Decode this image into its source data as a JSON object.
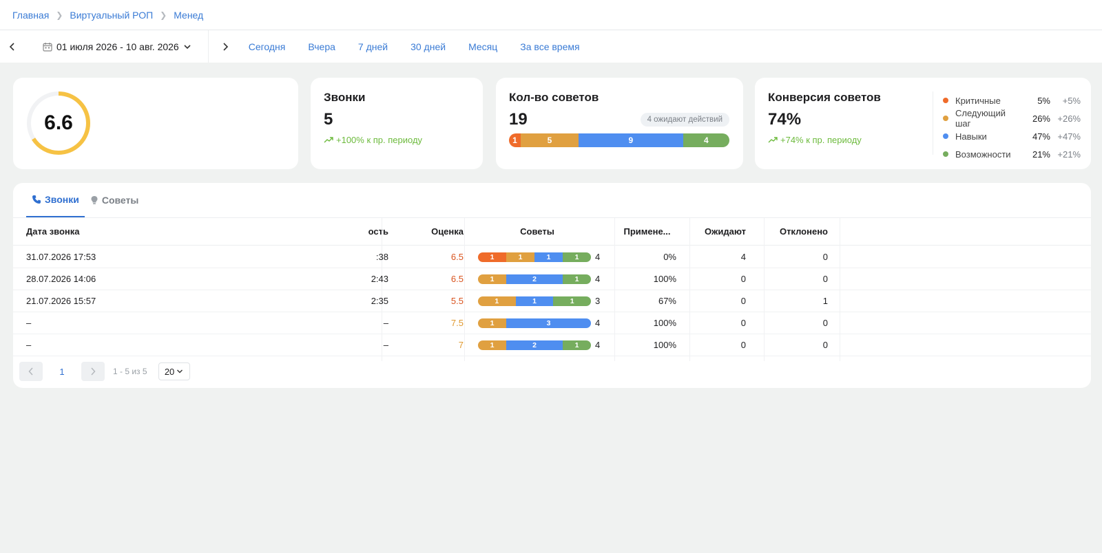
{
  "breadcrumb": [
    "Главная",
    "Виртуальный РОП",
    "Менед"
  ],
  "datebar": {
    "range": "01 июля 2026 - 10 авг. 2026",
    "quick": [
      "Сегодня",
      "Вчера",
      "7 дней",
      "30 дней",
      "Месяц",
      "За все время"
    ]
  },
  "score": {
    "value": "6.6",
    "fraction": 0.66,
    "color": "#f6c244"
  },
  "calls": {
    "title": "Звонки",
    "value": "5",
    "trend": "+100% к пр. периоду"
  },
  "tips": {
    "title": "Кол-во советов",
    "value": "19",
    "badge": "4 ожидают действий",
    "segments": [
      {
        "value": "1",
        "n": 1,
        "color": "#ef6b2a"
      },
      {
        "value": "5",
        "n": 5,
        "color": "#e0a040"
      },
      {
        "value": "9",
        "n": 9,
        "color": "#4f8ef0"
      },
      {
        "value": "4",
        "n": 4,
        "color": "#76ad5e"
      }
    ]
  },
  "conversion": {
    "title": "Конверсия советов",
    "value": "74%",
    "trend": "+74% к пр. периоду",
    "legend": [
      {
        "label": "Критичные",
        "pct": "5%",
        "delta": "+5%",
        "color": "#ef6b2a"
      },
      {
        "label": "Следующий шаг",
        "pct": "26%",
        "delta": "+26%",
        "color": "#e0a040"
      },
      {
        "label": "Навыки",
        "pct": "47%",
        "delta": "+47%",
        "color": "#4f8ef0"
      },
      {
        "label": "Возможности",
        "pct": "21%",
        "delta": "+21%",
        "color": "#76ad5e"
      }
    ]
  },
  "tabs": [
    "Звонки",
    "Советы"
  ],
  "table": {
    "headers": {
      "date": "Дата звонка",
      "duration": "ость",
      "score": "Оценка",
      "tips": "Советы",
      "applied": "Примене...",
      "waiting": "Ожидают",
      "rejected": "Отклонено"
    },
    "rows": [
      {
        "date": "31.07.2026 17:53",
        "duration": ":38",
        "score": "6.5",
        "score_color": "#d9531e",
        "tips": [
          {
            "v": "1",
            "c": "#ef6b2a"
          },
          {
            "v": "1",
            "c": "#e0a040"
          },
          {
            "v": "1",
            "c": "#4f8ef0"
          },
          {
            "v": "1",
            "c": "#76ad5e"
          }
        ],
        "tips_total": "4",
        "applied": "0%",
        "waiting": "4",
        "rejected": "0"
      },
      {
        "date": "28.07.2026 14:06",
        "duration": "2:43",
        "score": "6.5",
        "score_color": "#d9531e",
        "tips": [
          {
            "v": "1",
            "c": "#e0a040"
          },
          {
            "v": "2",
            "c": "#4f8ef0"
          },
          {
            "v": "1",
            "c": "#76ad5e"
          }
        ],
        "tips_total": "4",
        "applied": "100%",
        "waiting": "0",
        "rejected": "0"
      },
      {
        "date": "21.07.2026 15:57",
        "duration": "2:35",
        "score": "5.5",
        "score_color": "#d9531e",
        "tips": [
          {
            "v": "1",
            "c": "#e0a040"
          },
          {
            "v": "1",
            "c": "#4f8ef0"
          },
          {
            "v": "1",
            "c": "#76ad5e"
          }
        ],
        "tips_total": "3",
        "applied": "67%",
        "waiting": "0",
        "rejected": "1"
      },
      {
        "date": "–",
        "duration": "–",
        "score": "7.5",
        "score_color": "#e0992f",
        "tips": [
          {
            "v": "1",
            "c": "#e0a040"
          },
          {
            "v": "3",
            "c": "#4f8ef0"
          }
        ],
        "tips_total": "4",
        "applied": "100%",
        "waiting": "0",
        "rejected": "0"
      },
      {
        "date": "–",
        "duration": "–",
        "score": "7",
        "score_color": "#e0992f",
        "tips": [
          {
            "v": "1",
            "c": "#e0a040"
          },
          {
            "v": "2",
            "c": "#4f8ef0"
          },
          {
            "v": "1",
            "c": "#76ad5e"
          }
        ],
        "tips_total": "4",
        "applied": "100%",
        "waiting": "0",
        "rejected": "0"
      }
    ]
  },
  "pager": {
    "page": "1",
    "info": "1 - 5 из 5",
    "size": "20"
  }
}
